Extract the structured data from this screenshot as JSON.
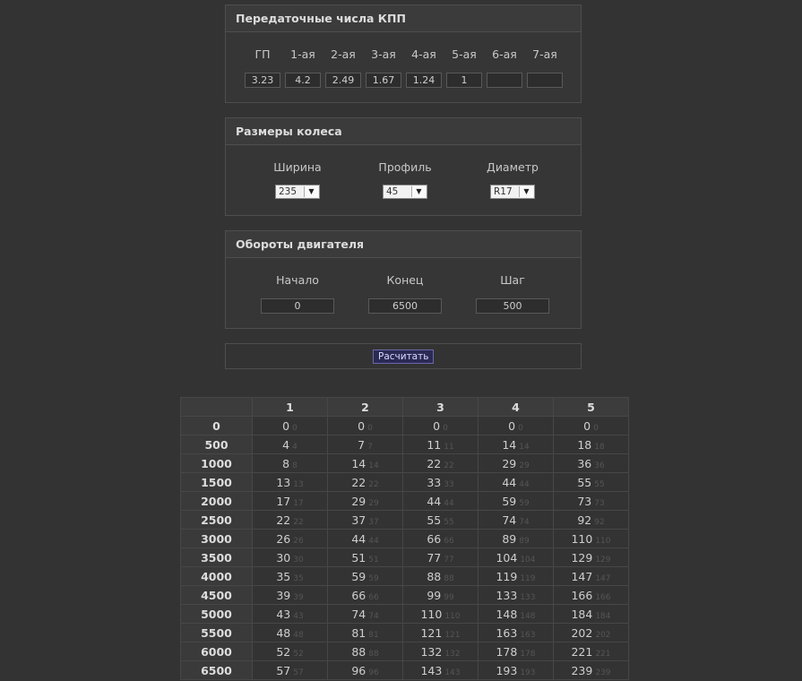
{
  "gears": {
    "title": "Передаточные числа КПП",
    "labels": [
      "ГП",
      "1-ая",
      "2-ая",
      "3-ая",
      "4-ая",
      "5-ая",
      "6-ая",
      "7-ая"
    ],
    "values": [
      "3.23",
      "4.2",
      "2.49",
      "1.67",
      "1.24",
      "1",
      "",
      ""
    ]
  },
  "wheel": {
    "title": "Размеры колеса",
    "width_label": "Ширина",
    "width_value": "235",
    "profile_label": "Профиль",
    "profile_value": "45",
    "diameter_label": "Диаметр",
    "diameter_value": "R17"
  },
  "rpm": {
    "title": "Обороты двигателя",
    "start_label": "Начало",
    "start_value": "0",
    "end_label": "Конец",
    "end_value": "6500",
    "step_label": "Шаг",
    "step_value": "500"
  },
  "calc": {
    "button_label": "Расчитать"
  },
  "results": {
    "columns": [
      "",
      "1",
      "2",
      "3",
      "4",
      "5"
    ],
    "rows": [
      {
        "rpm": "0",
        "cells": [
          [
            "0",
            "0"
          ],
          [
            "0",
            "0"
          ],
          [
            "0",
            "0"
          ],
          [
            "0",
            "0"
          ],
          [
            "0",
            "0"
          ]
        ]
      },
      {
        "rpm": "500",
        "cells": [
          [
            "4",
            "4"
          ],
          [
            "7",
            "7"
          ],
          [
            "11",
            "11"
          ],
          [
            "14",
            "14"
          ],
          [
            "18",
            "18"
          ]
        ]
      },
      {
        "rpm": "1000",
        "cells": [
          [
            "8",
            "8"
          ],
          [
            "14",
            "14"
          ],
          [
            "22",
            "22"
          ],
          [
            "29",
            "29"
          ],
          [
            "36",
            "36"
          ]
        ]
      },
      {
        "rpm": "1500",
        "cells": [
          [
            "13",
            "13"
          ],
          [
            "22",
            "22"
          ],
          [
            "33",
            "33"
          ],
          [
            "44",
            "44"
          ],
          [
            "55",
            "55"
          ]
        ]
      },
      {
        "rpm": "2000",
        "cells": [
          [
            "17",
            "17"
          ],
          [
            "29",
            "29"
          ],
          [
            "44",
            "44"
          ],
          [
            "59",
            "59"
          ],
          [
            "73",
            "73"
          ]
        ]
      },
      {
        "rpm": "2500",
        "cells": [
          [
            "22",
            "22"
          ],
          [
            "37",
            "37"
          ],
          [
            "55",
            "55"
          ],
          [
            "74",
            "74"
          ],
          [
            "92",
            "92"
          ]
        ]
      },
      {
        "rpm": "3000",
        "cells": [
          [
            "26",
            "26"
          ],
          [
            "44",
            "44"
          ],
          [
            "66",
            "66"
          ],
          [
            "89",
            "89"
          ],
          [
            "110",
            "110"
          ]
        ]
      },
      {
        "rpm": "3500",
        "cells": [
          [
            "30",
            "30"
          ],
          [
            "51",
            "51"
          ],
          [
            "77",
            "77"
          ],
          [
            "104",
            "104"
          ],
          [
            "129",
            "129"
          ]
        ]
      },
      {
        "rpm": "4000",
        "cells": [
          [
            "35",
            "35"
          ],
          [
            "59",
            "59"
          ],
          [
            "88",
            "88"
          ],
          [
            "119",
            "119"
          ],
          [
            "147",
            "147"
          ]
        ]
      },
      {
        "rpm": "4500",
        "cells": [
          [
            "39",
            "39"
          ],
          [
            "66",
            "66"
          ],
          [
            "99",
            "99"
          ],
          [
            "133",
            "133"
          ],
          [
            "166",
            "166"
          ]
        ]
      },
      {
        "rpm": "5000",
        "cells": [
          [
            "43",
            "43"
          ],
          [
            "74",
            "74"
          ],
          [
            "110",
            "110"
          ],
          [
            "148",
            "148"
          ],
          [
            "184",
            "184"
          ]
        ]
      },
      {
        "rpm": "5500",
        "cells": [
          [
            "48",
            "48"
          ],
          [
            "81",
            "81"
          ],
          [
            "121",
            "121"
          ],
          [
            "163",
            "163"
          ],
          [
            "202",
            "202"
          ]
        ]
      },
      {
        "rpm": "6000",
        "cells": [
          [
            "52",
            "52"
          ],
          [
            "88",
            "88"
          ],
          [
            "132",
            "132"
          ],
          [
            "178",
            "178"
          ],
          [
            "221",
            "221"
          ]
        ]
      },
      {
        "rpm": "6500",
        "cells": [
          [
            "57",
            "57"
          ],
          [
            "96",
            "96"
          ],
          [
            "143",
            "143"
          ],
          [
            "193",
            "193"
          ],
          [
            "239",
            "239"
          ]
        ]
      }
    ]
  }
}
